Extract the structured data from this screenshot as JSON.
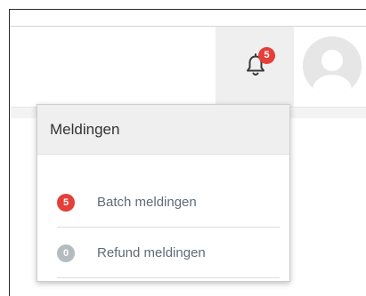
{
  "header": {
    "notification_count": "5",
    "colors": {
      "badge_red": "#e43f38",
      "badge_gray": "#b5bcc0"
    }
  },
  "notifications_dropdown": {
    "title": "Meldingen",
    "items": [
      {
        "count": "5",
        "label": "Batch meldingen",
        "badge_color": "#e43f38"
      },
      {
        "count": "0",
        "label": "Refund meldingen",
        "badge_color": "#b5bcc0"
      }
    ]
  }
}
